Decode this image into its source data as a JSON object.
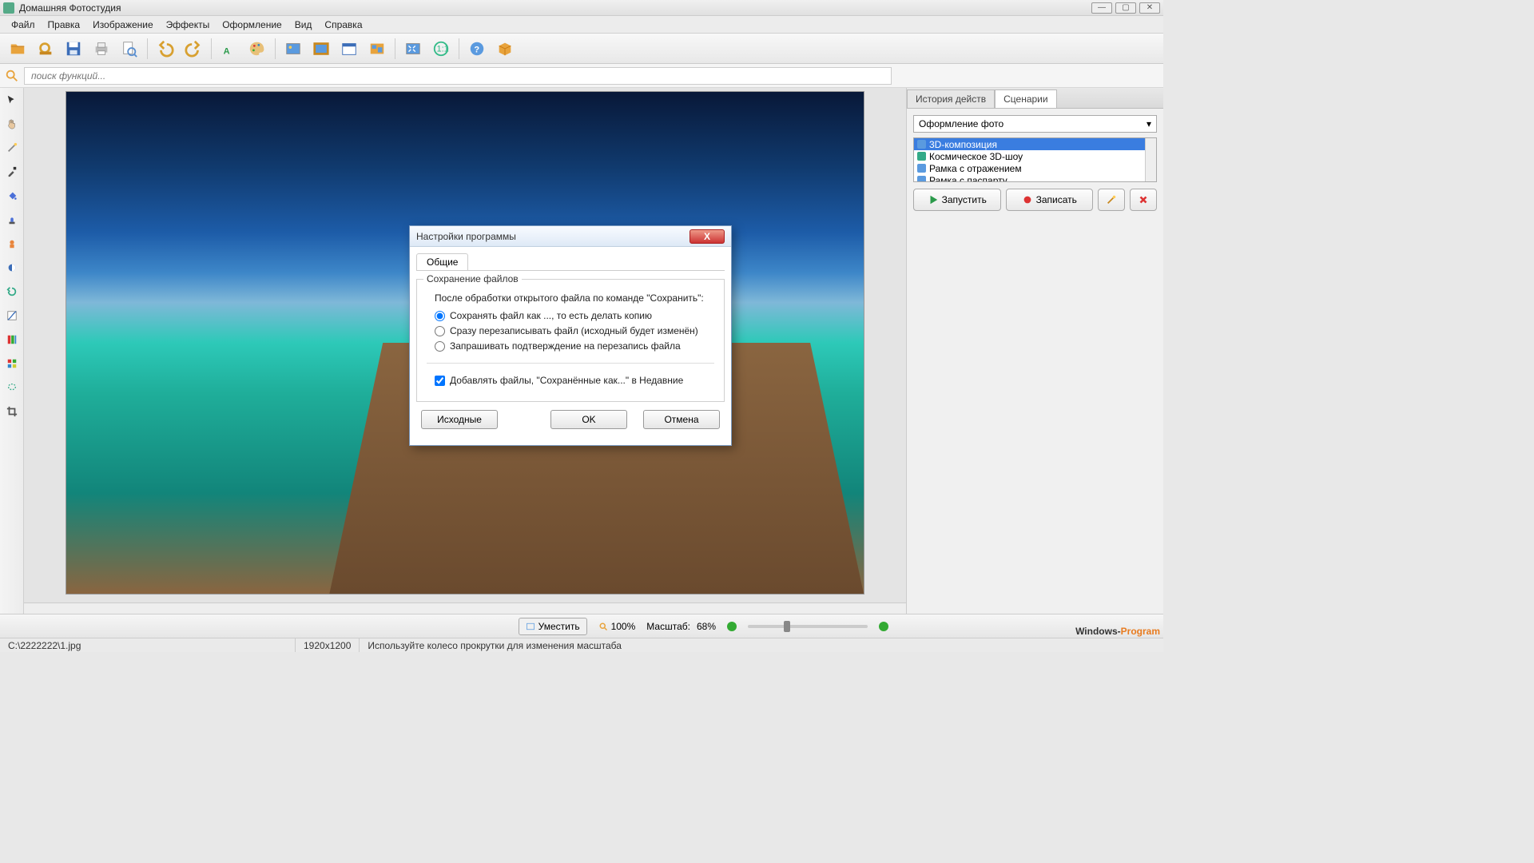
{
  "titlebar": {
    "title": "Домашняя Фотостудия"
  },
  "menu": {
    "file": "Файл",
    "edit": "Правка",
    "image": "Изображение",
    "effects": "Эффекты",
    "design": "Оформление",
    "view": "Вид",
    "help": "Справка"
  },
  "search": {
    "placeholder": "поиск функций..."
  },
  "rightpanel": {
    "tab_history": "История действ",
    "tab_scenarios": "Сценарии",
    "combo": "Оформление фото",
    "items": [
      "3D-композиция",
      "Космическое 3D-шоу",
      "Рамка с отражением",
      "Рамка с паспарту"
    ],
    "run": "Запустить",
    "record": "Записать"
  },
  "bottom": {
    "fit": "Уместить",
    "percent": "100%",
    "scale_label": "Масштаб:",
    "scale_value": "68%"
  },
  "status": {
    "path": "C:\\2222222\\1.jpg",
    "dims": "1920x1200",
    "hint": "Используйте колесо прокрутки для изменения масштаба"
  },
  "dialog": {
    "title": "Настройки программы",
    "tab": "Общие",
    "fieldset_title": "Сохранение файлов",
    "desc": "После обработки открытого файла по команде \"Сохранить\":",
    "radio1": "Сохранять файл как ..., то есть делать копию",
    "radio2": "Сразу перезаписывать файл (исходный будет изменён)",
    "radio3": "Запрашивать подтверждение на перезапись файла",
    "check1": "Добавлять файлы, \"Сохранённые как...\" в Недавние",
    "btn_defaults": "Исходные",
    "btn_ok": "OK",
    "btn_cancel": "Отмена"
  },
  "watermark": {
    "part1": "Windows-",
    "part2": "Program"
  }
}
